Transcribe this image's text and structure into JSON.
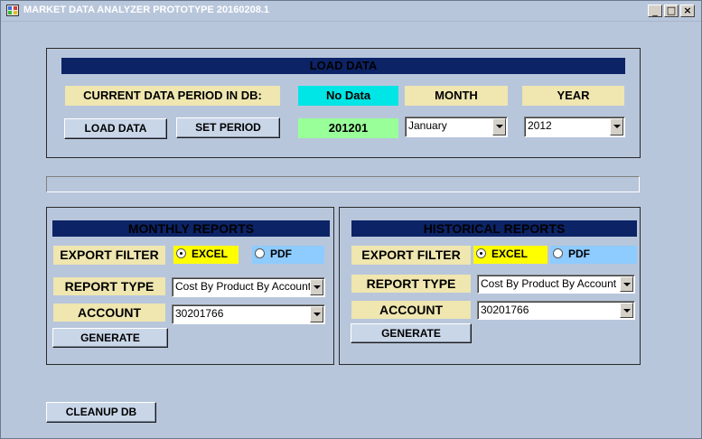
{
  "window": {
    "title": "MARKET DATA ANALYZER PROTOTYPE 20160208.1",
    "minimize": "_",
    "maximize": "□",
    "close": "×"
  },
  "load_data": {
    "header": "LOAD DATA",
    "current_period_label": "CURRENT DATA PERIOD IN DB:",
    "current_period_value": "No Data",
    "selected_period": "201201",
    "month_label": "MONTH",
    "year_label": "YEAR",
    "month_value": "January",
    "year_value": "2012",
    "load_button": "LOAD DATA",
    "set_period_button": "SET PERIOD"
  },
  "monthly": {
    "header": "MONTHLY REPORTS",
    "export_filter_label": "EXPORT FILTER",
    "excel_label": "EXCEL",
    "pdf_label": "PDF",
    "report_type_label": "REPORT TYPE",
    "report_type_value": "Cost By Product By Account",
    "account_label": "ACCOUNT",
    "account_value": "30201766",
    "generate_button": "GENERATE"
  },
  "historical": {
    "header": "HISTORICAL REPORTS",
    "export_filter_label": "EXPORT FILTER",
    "excel_label": "EXCEL",
    "pdf_label": "PDF",
    "report_type_label": "REPORT TYPE",
    "report_type_value": "Cost By Product By Account",
    "account_label": "ACCOUNT",
    "account_value": "30201766",
    "generate_button": "GENERATE"
  },
  "cleanup_button": "CLEANUP DB",
  "colors": {
    "header_bar": "#0c2366",
    "label_bg": "#efe6b0",
    "no_data_bg": "#00e5e5",
    "period_bg": "#99ff99",
    "excel_bg": "#ffff00",
    "pdf_bg": "#8ecbff"
  }
}
